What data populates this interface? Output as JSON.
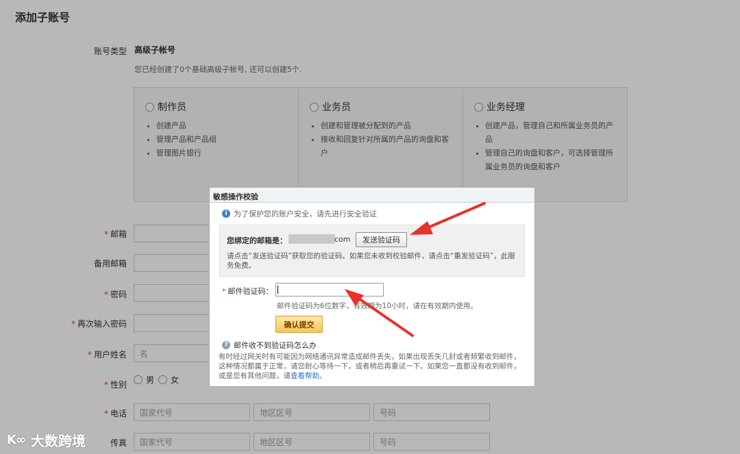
{
  "page": {
    "title": "添加子账号",
    "account_type_label": "账号类型",
    "account_type_value": "高级子帐号",
    "account_type_note": "您已经创建了0个基础高级子帐号, 还可以创建5个."
  },
  "roles": [
    {
      "name": "制作员",
      "items": [
        "创建产品",
        "管理产品和产品组",
        "管理图片银行"
      ]
    },
    {
      "name": "业务员",
      "items": [
        "创建和管理被分配到的产品",
        "接收和回复针对所属的产品的询盘和客户"
      ]
    },
    {
      "name": "业务经理",
      "items": [
        "创建产品，管理自己和所属业务员的产品",
        "管理自己的询盘和客户，可选择管理所属业务员的询盘和客户"
      ]
    }
  ],
  "form": {
    "email_label": "邮箱",
    "backup_email_label": "备用邮箱",
    "password_label": "密码",
    "confirm_password_label": "再次输入密码",
    "name_label": "用户姓名",
    "name_placeholder": "名",
    "gender_label": "性别",
    "gender_male": "男",
    "gender_female": "女",
    "phone_label": "电话",
    "fax_label": "传真",
    "country_code_placeholder": "国家代号",
    "area_code_placeholder": "地区区号",
    "number_placeholder": "号码",
    "required_mark": "*"
  },
  "dialog": {
    "title": "敏感操作校验",
    "info": "为了保护您的账户安全，请先进行安全验证",
    "bound_email_label": "您绑定的邮箱是：",
    "bound_email_suffix": "com",
    "send_code_button": "发送验证码",
    "send_hint": "请点击“发送验证码”获取您的验证码。如果您未收到校验邮件，请点击“重发验证码”，此服务免费。",
    "code_label": "邮件验证码：",
    "code_value": "",
    "code_hint": "邮件验证码为6位数字，有效期为10小时，请在有效期内使用。",
    "confirm_button": "确认提交",
    "faq_title": "邮件收不到验证码怎么办",
    "faq_text": "有时经过网关时有可能因为网络通讯异常造成邮件丢失，如果出现丢失几封或者频繁收到邮件，这种情况都属于正常，请您耐心等待一下，或者稍后再重试一下。如果您一直都没有收到邮件，或是您有其他问题，请",
    "faq_link": "查看帮助",
    "faq_end": "。"
  },
  "watermark": {
    "logo": "K∞",
    "text": "大数跨境"
  },
  "colors": {
    "arrow": "#e8322a",
    "required": "#e4393c",
    "link": "#2a6fc9"
  }
}
